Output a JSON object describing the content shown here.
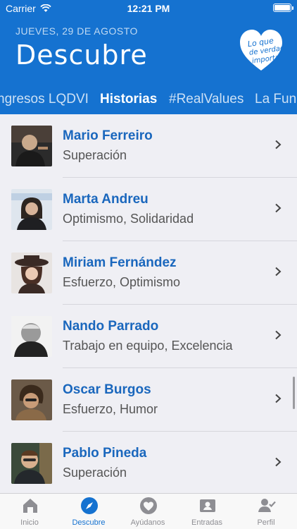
{
  "status_bar": {
    "carrier": "Carrier",
    "time": "12:21 PM"
  },
  "header": {
    "date": "JUEVES, 29 DE AGOSTO",
    "title": "Descubre",
    "logo_text": "Lo que de verdad importa"
  },
  "category_tabs": [
    {
      "label": "ngresos LQDVI",
      "active": false
    },
    {
      "label": "Historias",
      "active": true
    },
    {
      "label": "#RealValues",
      "active": false
    },
    {
      "label": "La Fun",
      "active": false
    }
  ],
  "people": [
    {
      "name": "Mario Ferreiro",
      "values": "Superación"
    },
    {
      "name": "Marta Andreu",
      "values": "Optimismo, Solidaridad"
    },
    {
      "name": "Miriam Fernández",
      "values": "Esfuerzo, Optimismo"
    },
    {
      "name": "Nando Parrado",
      "values": "Trabajo en equipo, Excelencia"
    },
    {
      "name": "Oscar Burgos",
      "values": "Esfuerzo, Humor"
    },
    {
      "name": "Pablo Pineda",
      "values": "Superación"
    }
  ],
  "tab_bar": [
    {
      "label": "Inicio",
      "icon": "home-icon",
      "active": false
    },
    {
      "label": "Descubre",
      "icon": "compass-icon",
      "active": true
    },
    {
      "label": "Ayúdanos",
      "icon": "heart-icon",
      "active": false
    },
    {
      "label": "Entradas",
      "icon": "ticket-icon",
      "active": false
    },
    {
      "label": "Perfil",
      "icon": "profile-icon",
      "active": false
    }
  ],
  "colors": {
    "brand_blue": "#1572d0",
    "name_blue": "#1a67bd",
    "inactive_gray": "#8e8e93"
  }
}
